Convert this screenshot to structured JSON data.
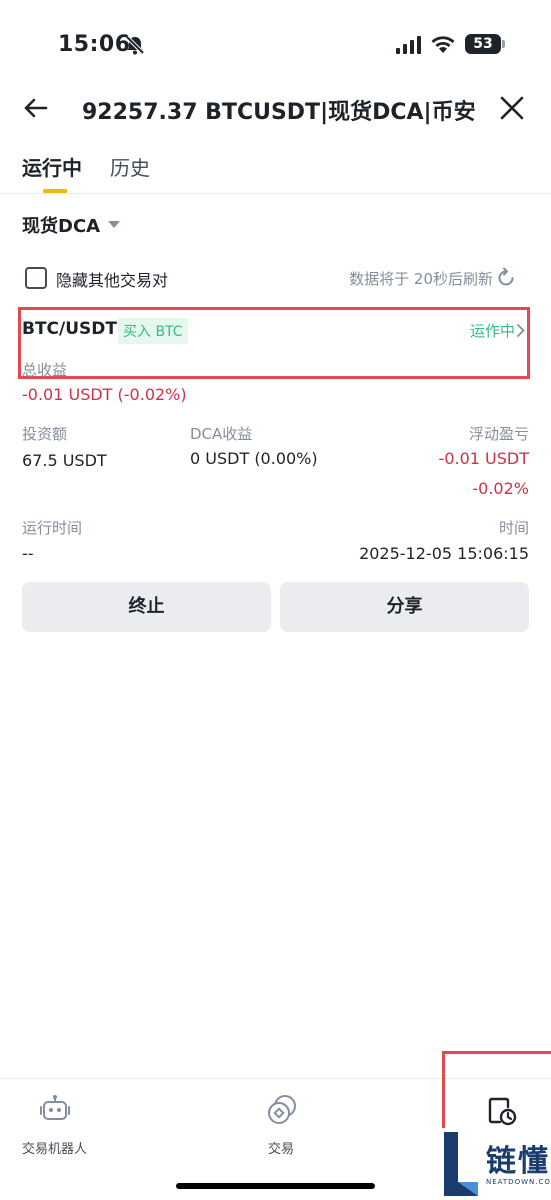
{
  "status_bar": {
    "time": "15:06",
    "battery": "53"
  },
  "header": {
    "title": "92257.37 BTCUSDT|现货DCA|币安"
  },
  "tabs": [
    {
      "label": "运行中"
    },
    {
      "label": "历史"
    }
  ],
  "filter": {
    "label": "现货DCA"
  },
  "options": {
    "hide_label": "隐藏其他交易对",
    "refresh_text": "数据将于 20秒后刷新"
  },
  "position": {
    "pair": "BTC/USDT",
    "side_badge": "买入 BTC",
    "status": "运作中",
    "total_pnl_label": "总收益",
    "total_pnl_value": "-0.01 USDT (-0.02%)",
    "investment_label": "投资额",
    "investment_value": "67.5 USDT",
    "dca_label": "DCA收益",
    "dca_value": "0 USDT (0.00%)",
    "float_label": "浮动盈亏",
    "float_value": "-0.01 USDT",
    "float_pct": "-0.02%",
    "runtime_label": "运行时间",
    "runtime_value": "--",
    "time_label": "时间",
    "time_value": "2025-12-05 15:06:15"
  },
  "actions": {
    "stop": "终止",
    "share": "分享"
  },
  "bottom_nav": [
    {
      "label": "交易机器人"
    },
    {
      "label": "交易"
    }
  ],
  "watermark": {
    "text": "链懂",
    "sub": "NEATDOWN.COM"
  },
  "colors": {
    "accent": "#f0b90b",
    "positive": "#2ebd85",
    "negative": "#cf304a",
    "highlight": "#e5484d"
  }
}
